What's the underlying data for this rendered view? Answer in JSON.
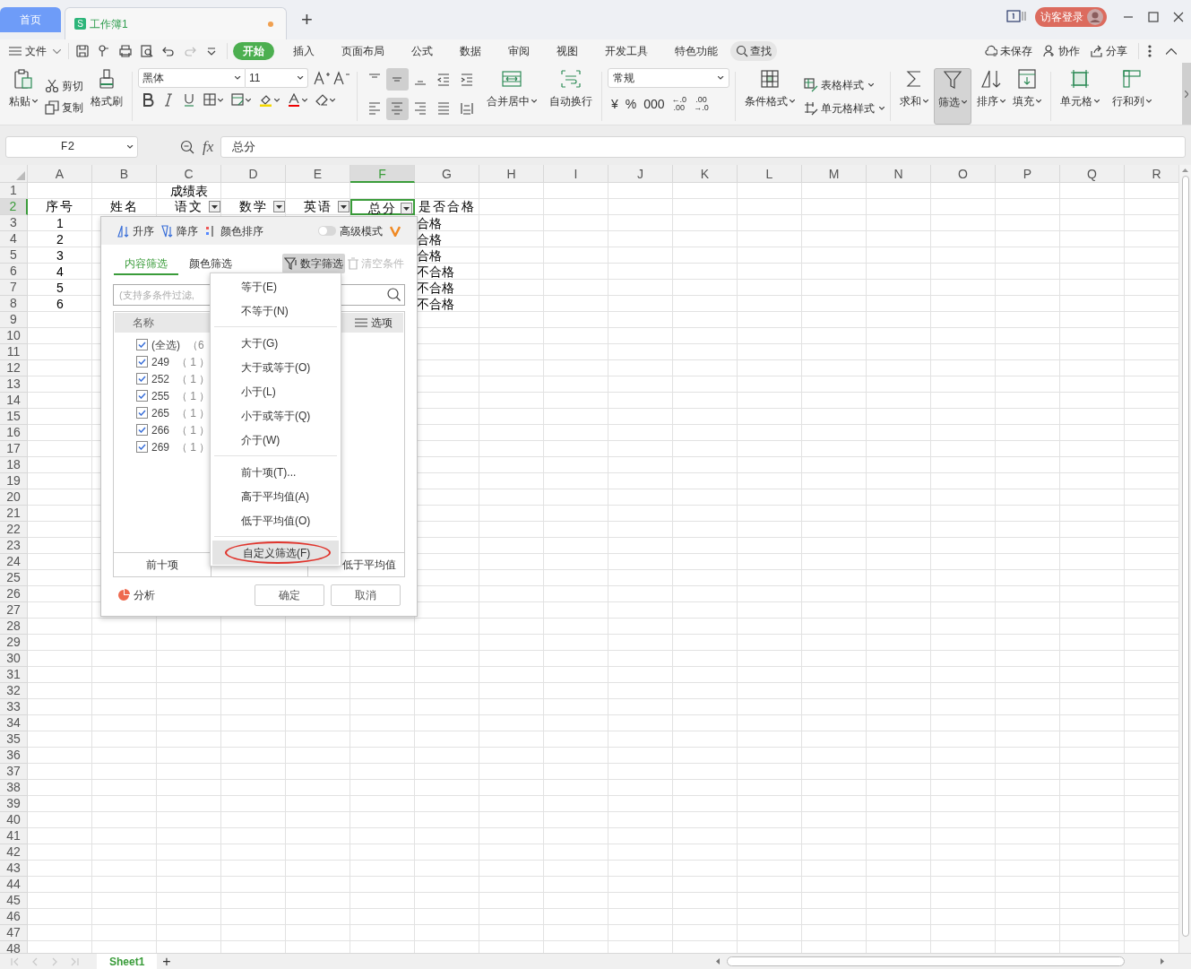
{
  "window": {
    "home_tab": "首页",
    "document_tab": {
      "icon_text": "S",
      "title": "工作簿1",
      "unsaved": true
    },
    "new_tab": "+",
    "login_button": "访客登录"
  },
  "menu": {
    "file": "文件",
    "tabs": [
      {
        "label": "开始",
        "selected": true
      },
      {
        "label": "插入",
        "selected": false
      },
      {
        "label": "页面布局",
        "selected": false
      },
      {
        "label": "公式",
        "selected": false
      },
      {
        "label": "数据",
        "selected": false
      },
      {
        "label": "审阅",
        "selected": false
      },
      {
        "label": "视图",
        "selected": false
      },
      {
        "label": "开发工具",
        "selected": false
      },
      {
        "label": "特色功能",
        "selected": false
      }
    ],
    "search": "查找",
    "actions": [
      "未保存",
      "协作",
      "分享"
    ]
  },
  "ribbon": {
    "paste": "粘贴",
    "cut": "剪切",
    "copy": "复制",
    "format_painter": "格式刷",
    "font_name": "黑体",
    "font_size": "11",
    "vertical_align": [
      {
        "selected": false
      },
      {
        "selected": true
      },
      {
        "selected": false
      }
    ],
    "horizontal_align": [
      {
        "selected": false
      },
      {
        "selected": true
      },
      {
        "selected": false
      },
      {
        "selected": false
      }
    ],
    "merge_center": "合并居中",
    "wrap_text": "自动换行",
    "number_format": "常规",
    "number_buttons": [
      "¥",
      "%",
      "000",
      "←.0\n.00",
      ".00\n→.0"
    ],
    "conditional_format": "条件格式",
    "table_style": "表格样式",
    "cell_style": "单元格样式",
    "sum": "求和",
    "filter": {
      "label": "筛选",
      "selected": true
    },
    "sort": "排序",
    "fill": "填充",
    "cell": "单元格",
    "rows_columns": "行和列"
  },
  "formula_bar": {
    "name_box": "F2",
    "fx": "fx",
    "value": "总分"
  },
  "sheet": {
    "columns": [
      {
        "label": "A",
        "selected": false
      },
      {
        "label": "B",
        "selected": false
      },
      {
        "label": "C",
        "selected": false
      },
      {
        "label": "D",
        "selected": false
      },
      {
        "label": "E",
        "selected": false
      },
      {
        "label": "F",
        "selected": true
      },
      {
        "label": "G",
        "selected": false
      },
      {
        "label": "H",
        "selected": false
      },
      {
        "label": "I",
        "selected": false
      },
      {
        "label": "J",
        "selected": false
      },
      {
        "label": "K",
        "selected": false
      },
      {
        "label": "L",
        "selected": false
      },
      {
        "label": "M",
        "selected": false
      },
      {
        "label": "N",
        "selected": false
      },
      {
        "label": "O",
        "selected": false
      },
      {
        "label": "P",
        "selected": false
      },
      {
        "label": "Q",
        "selected": false
      },
      {
        "label": "R",
        "selected": false
      }
    ],
    "row_numbers": [
      {
        "label": "1",
        "selected": false
      },
      {
        "label": "2",
        "selected": true
      },
      {
        "label": "3",
        "selected": false
      },
      {
        "label": "4",
        "selected": false
      },
      {
        "label": "5",
        "selected": false
      },
      {
        "label": "6",
        "selected": false
      },
      {
        "label": "7",
        "selected": false
      },
      {
        "label": "8",
        "selected": false
      },
      {
        "label": "9",
        "selected": false
      },
      {
        "label": "10",
        "selected": false
      },
      {
        "label": "11",
        "selected": false
      },
      {
        "label": "12",
        "selected": false
      },
      {
        "label": "13",
        "selected": false
      },
      {
        "label": "14",
        "selected": false
      },
      {
        "label": "15",
        "selected": false
      },
      {
        "label": "16",
        "selected": false
      },
      {
        "label": "17",
        "selected": false
      },
      {
        "label": "18",
        "selected": false
      },
      {
        "label": "19",
        "selected": false
      },
      {
        "label": "20",
        "selected": false
      },
      {
        "label": "21",
        "selected": false
      },
      {
        "label": "22",
        "selected": false
      },
      {
        "label": "23",
        "selected": false
      },
      {
        "label": "24",
        "selected": false
      },
      {
        "label": "25",
        "selected": false
      },
      {
        "label": "26",
        "selected": false
      },
      {
        "label": "27",
        "selected": false
      },
      {
        "label": "28",
        "selected": false
      },
      {
        "label": "29",
        "selected": false
      },
      {
        "label": "30",
        "selected": false
      },
      {
        "label": "31",
        "selected": false
      },
      {
        "label": "32",
        "selected": false
      },
      {
        "label": "33",
        "selected": false
      },
      {
        "label": "34",
        "selected": false
      },
      {
        "label": "35",
        "selected": false
      },
      {
        "label": "36",
        "selected": false
      },
      {
        "label": "37",
        "selected": false
      },
      {
        "label": "38",
        "selected": false
      },
      {
        "label": "39",
        "selected": false
      },
      {
        "label": "40",
        "selected": false
      },
      {
        "label": "41",
        "selected": false
      },
      {
        "label": "42",
        "selected": false
      },
      {
        "label": "43",
        "selected": false
      },
      {
        "label": "44",
        "selected": false
      },
      {
        "label": "45",
        "selected": false
      },
      {
        "label": "46",
        "selected": false
      },
      {
        "label": "47",
        "selected": false
      },
      {
        "label": "48",
        "selected": false
      }
    ],
    "title": "成绩表",
    "headers": [
      {
        "text": "序号",
        "filter": false,
        "active": false
      },
      {
        "text": "姓名",
        "filter": false,
        "active": false
      },
      {
        "text": "语文",
        "filter": true,
        "active": false
      },
      {
        "text": "数学",
        "filter": true,
        "active": false
      },
      {
        "text": "英语",
        "filter": true,
        "active": false
      },
      {
        "text": "总分",
        "filter": true,
        "active": true
      },
      {
        "text": "是否合格",
        "filter": false,
        "active": false
      }
    ],
    "rows": [
      {
        "number": "1",
        "result": "合格"
      },
      {
        "number": "2",
        "result": "合格"
      },
      {
        "number": "3",
        "result": "合格"
      },
      {
        "number": "4",
        "result": "不合格"
      },
      {
        "number": "5",
        "result": "不合格"
      },
      {
        "number": "6",
        "result": "不合格"
      }
    ]
  },
  "filter_popup": {
    "sort_buttons": [
      "升序",
      "降序",
      "颜色排序"
    ],
    "advanced_mode": {
      "label": "高级模式",
      "on": false
    },
    "tabs": [
      {
        "label": "内容筛选",
        "selected": true
      },
      {
        "label": "颜色筛选",
        "selected": false
      }
    ],
    "number_filter": {
      "label": "数字筛选",
      "selected": true
    },
    "clear_conditions": {
      "label": "清空条件",
      "disabled": true
    },
    "search": {
      "placeholder": "(支持多条件过滤,"
    },
    "list_header": "名称",
    "options": "选项",
    "items": [
      {
        "value": "(全选)",
        "count": "（6",
        "checked": true
      },
      {
        "value": "249",
        "count": "（ 1 ）",
        "checked": true
      },
      {
        "value": "252",
        "count": "（ 1 ）",
        "checked": true
      },
      {
        "value": "255",
        "count": "（ 1 ）",
        "checked": true
      },
      {
        "value": "265",
        "count": "（ 1 ）",
        "checked": true
      },
      {
        "value": "266",
        "count": "（ 1 ）",
        "checked": true
      },
      {
        "value": "269",
        "count": "（ 1 ）",
        "checked": true
      }
    ],
    "quick_buttons": [
      "前十项",
      "低于平均值"
    ],
    "analysis": "分析",
    "ok": "确定",
    "cancel": "取消"
  },
  "number_filter_menu": {
    "groups": [
      {
        "items": [
          {
            "label": "等于(E)",
            "highlighted": false,
            "circled": false
          },
          {
            "label": "不等于(N)",
            "highlighted": false,
            "circled": false
          }
        ]
      },
      {
        "items": [
          {
            "label": "大于(G)",
            "highlighted": false,
            "circled": false
          },
          {
            "label": "大于或等于(O)",
            "highlighted": false,
            "circled": false
          },
          {
            "label": "小于(L)",
            "highlighted": false,
            "circled": false
          },
          {
            "label": "小于或等于(Q)",
            "highlighted": false,
            "circled": false
          },
          {
            "label": "介于(W)",
            "highlighted": false,
            "circled": false
          }
        ]
      },
      {
        "items": [
          {
            "label": "前十项(T)...",
            "highlighted": false,
            "circled": false
          },
          {
            "label": "高于平均值(A)",
            "highlighted": false,
            "circled": false
          },
          {
            "label": "低于平均值(O)",
            "highlighted": false,
            "circled": false
          }
        ]
      },
      {
        "items": [
          {
            "label": "自定义筛选(F)",
            "highlighted": true,
            "circled": true
          }
        ]
      }
    ]
  },
  "sheet_tabs": [
    {
      "label": "Sheet1",
      "selected": true
    }
  ],
  "add_sheet": "+"
}
